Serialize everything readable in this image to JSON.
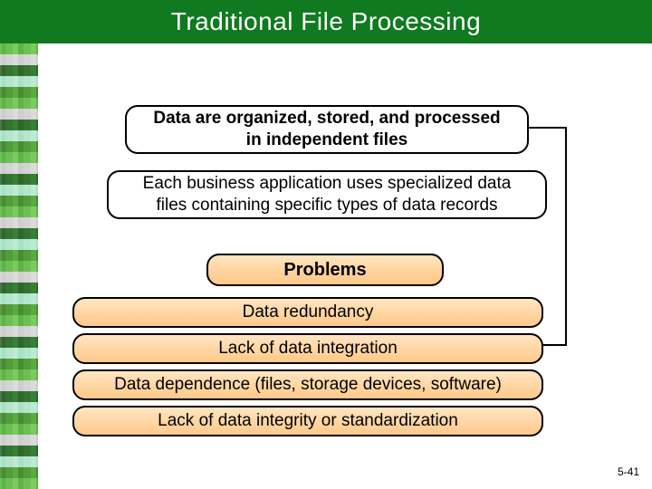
{
  "title": "Traditional File Processing",
  "box_intro_l1": "Data are organized, stored, and processed",
  "box_intro_l2": "in independent files",
  "box_detail_l1": "Each business application uses specialized data",
  "box_detail_l2": "files containing specific types of data records",
  "problems_header": "Problems",
  "problems": {
    "p1": "Data redundancy",
    "p2": "Lack of data integration",
    "p3": "Data dependence (files, storage devices, software)",
    "p4": "Lack of data integrity or standardization"
  },
  "page_number": "5-41"
}
